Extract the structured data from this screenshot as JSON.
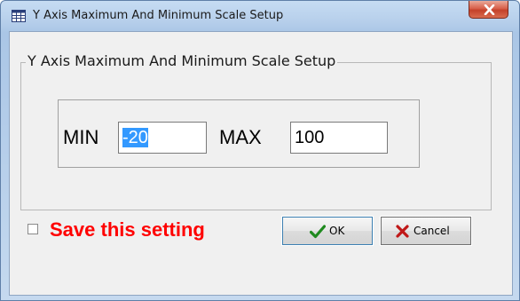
{
  "window": {
    "title": "Y Axis Maximum And Minimum Scale Setup",
    "icon": "table-app-icon",
    "close_icon": "close-x-icon"
  },
  "group": {
    "legend": "Y Axis Maximum And Minimum Scale Setup"
  },
  "fields": {
    "min_label": "MIN",
    "min_value": "-20",
    "max_label": "MAX",
    "max_value": "100"
  },
  "options": {
    "save_label": "Save this setting",
    "save_checked": false,
    "save_color": "#ff0000"
  },
  "buttons": {
    "ok_label": "OK",
    "ok_icon": "green-check-icon",
    "cancel_label": "Cancel",
    "cancel_icon": "red-x-icon"
  }
}
